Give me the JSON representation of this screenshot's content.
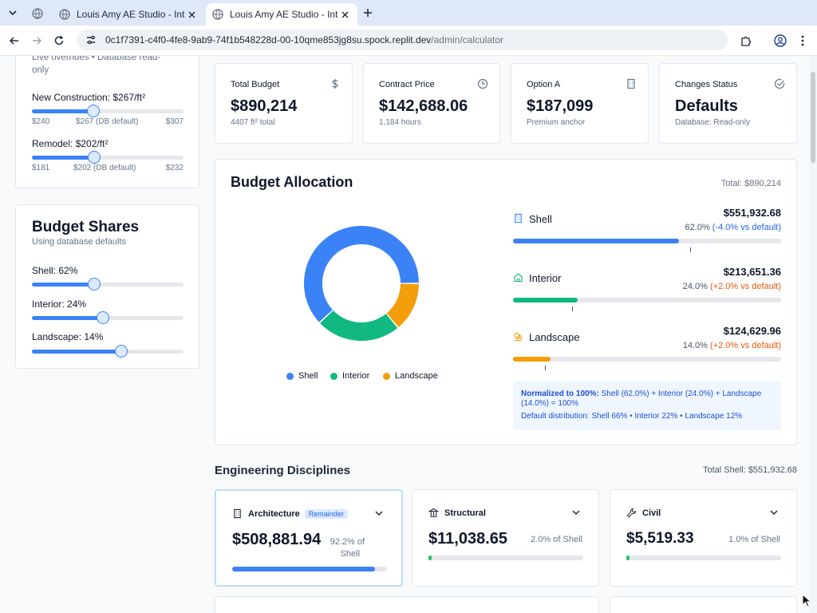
{
  "browser": {
    "tabs": [
      {
        "title": "Louis Amy AE Studio - Interac",
        "active": false
      },
      {
        "title": "Louis Amy AE Studio - Interac",
        "active": true
      }
    ],
    "url_host": "0c1f7391-c4f0-4fe8-9ab9-74f1b548228d-00-10qme853jg8su.spock.replit.dev",
    "url_path": "/admin/calculator"
  },
  "sidebar": {
    "rates_caption_line1": "Live overrides • Database read-",
    "rates_caption_line2": "only",
    "new_construction": {
      "label": "New Construction: $267/ft²",
      "min": "$240",
      "default": "$267 (DB default)",
      "max": "$307",
      "value": 267,
      "range": [
        240,
        307
      ]
    },
    "remodel": {
      "label": "Remodel: $202/ft²",
      "min": "$181",
      "default": "$202 (DB default)",
      "max": "$232",
      "value": 202,
      "range": [
        181,
        232
      ]
    },
    "shares_title": "Budget Shares",
    "shares_subtitle": "Using database defaults",
    "shares": [
      {
        "label": "Shell: 62%",
        "value": 0.41
      },
      {
        "label": "Interior: 24%",
        "value": 0.47
      },
      {
        "label": "Landscape: 14%",
        "value": 0.59
      }
    ]
  },
  "stats": [
    {
      "label": "Total Budget",
      "value": "$890,214",
      "sub": "4407 ft² total",
      "icon": "dollar-icon"
    },
    {
      "label": "Contract Price",
      "value": "$142,688.06",
      "sub": "1,184 hours",
      "icon": "clock-icon"
    },
    {
      "label": "Option A",
      "value": "$187,099",
      "sub": "Premium anchor",
      "icon": "building-icon"
    },
    {
      "label": "Changes Status",
      "value": "Defaults",
      "sub": "Database: Read-only",
      "icon": "check-circle-icon"
    }
  ],
  "allocation": {
    "title": "Budget Allocation",
    "total": "Total: $890,214",
    "legend": [
      "Shell",
      "Interior",
      "Landscape"
    ],
    "colors": {
      "shell": "#3b82f6",
      "interior": "#10b981",
      "landscape": "#f59e0b"
    },
    "rows": [
      {
        "name": "Shell",
        "amount": "$551,932.68",
        "pct": "62.0%",
        "delta": "(-4.0% vs default)",
        "delta_dir": "neg",
        "value": 62,
        "default": 66,
        "color": "#3b82f6",
        "icon": "building-icon"
      },
      {
        "name": "Interior",
        "amount": "$213,651.36",
        "pct": "24.0%",
        "delta": "(+2.0% vs default)",
        "delta_dir": "pos",
        "value": 24,
        "default": 22,
        "color": "#10b981",
        "icon": "home-icon"
      },
      {
        "name": "Landscape",
        "amount": "$124,629.96",
        "pct": "14.0%",
        "delta": "(+2.0% vs default)",
        "delta_dir": "pos",
        "value": 14,
        "default": 12,
        "color": "#f59e0b",
        "icon": "trees-icon"
      }
    ],
    "note_bold": "Normalized to 100%:",
    "note_rest": " Shell (62.0%) + Interior (24.0%) + Landscape (14.0%) = 100%",
    "note_default": "Default distribution: Shell 66% • Interior 22% • Landscape 12%"
  },
  "engineering": {
    "title": "Engineering Disciplines",
    "total": "Total Shell: $551,932.68",
    "cards": [
      {
        "name": "Architecture",
        "badge": "Remainder",
        "amount": "$508,881.94",
        "share_line1": "92.2% of",
        "share_line2": "Shell",
        "value": 92.2,
        "color": "#3b82f6",
        "icon": "building-icon"
      },
      {
        "name": "Structural",
        "badge": "",
        "amount": "$11,038.65",
        "share_line1": "2.0% of Shell",
        "share_line2": "",
        "value": 2.0,
        "color": "#22c55e",
        "icon": "landmark-icon"
      },
      {
        "name": "Civil",
        "badge": "",
        "amount": "$5,519.33",
        "share_line1": "1.0% of Shell",
        "share_line2": "",
        "value": 1.0,
        "color": "#22c55e",
        "icon": "wrench-icon"
      }
    ]
  }
}
